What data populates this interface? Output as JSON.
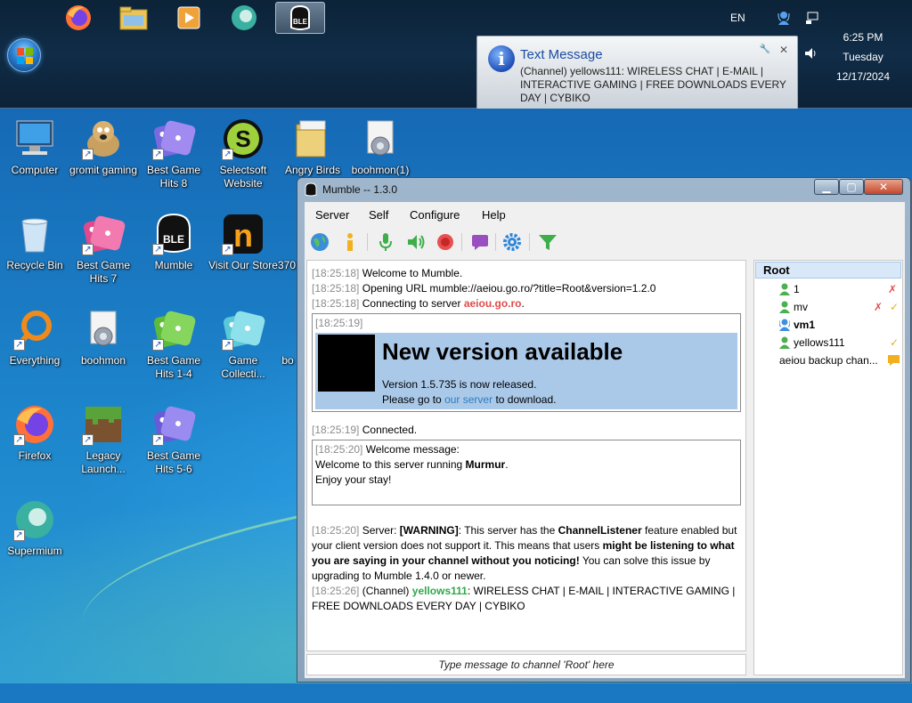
{
  "taskbar": {
    "pinned": [
      {
        "name": "firefox-icon"
      },
      {
        "name": "file-explorer-icon"
      },
      {
        "name": "media-player-icon"
      },
      {
        "name": "supermium-icon"
      },
      {
        "name": "mumble-icon",
        "active": true
      }
    ],
    "language": "EN",
    "clock": {
      "time": "6:25 PM",
      "day": "Tuesday",
      "date": "12/17/2024"
    }
  },
  "notification": {
    "title": "Text Message",
    "text": "(Channel) yellows111: WIRELESS CHAT | E-MAIL | INTERACTIVE GAMING | FREE DOWNLOADS EVERY DAY | CYBIKO"
  },
  "desktop": {
    "icons": [
      {
        "label": "Computer"
      },
      {
        "label": "gromit gaming"
      },
      {
        "label": "Best Game Hits 8"
      },
      {
        "label": "Selectsoft Website"
      },
      {
        "label": "Angry Birds"
      },
      {
        "label": "boohmon(1)"
      },
      {
        "label": "Recycle Bin"
      },
      {
        "label": "Best Game Hits 7"
      },
      {
        "label": "Mumble"
      },
      {
        "label": "Visit Our Store"
      },
      {
        "label": "370"
      },
      {
        "label": "Everything"
      },
      {
        "label": "boohmon"
      },
      {
        "label": "Best Game Hits 1-4"
      },
      {
        "label": "Game Collecti..."
      },
      {
        "label": "bo"
      },
      {
        "label": "Firefox"
      },
      {
        "label": "Legacy Launch..."
      },
      {
        "label": "Best Game Hits 5-6"
      },
      {
        "label": "Supermium"
      }
    ]
  },
  "window": {
    "title": "Mumble -- 1.3.0",
    "menu": [
      "Server",
      "Self",
      "Configure",
      "Help"
    ],
    "toolbar": [
      "connect-icon",
      "info-icon",
      "microphone-icon",
      "speaker-icon",
      "record-icon",
      "chat-bubble-icon",
      "settings-gear-icon",
      "filter-icon"
    ],
    "log": {
      "l1": {
        "ts": "[18:25:18]",
        "text": "Welcome to Mumble."
      },
      "l2": {
        "ts": "[18:25:18]",
        "text": "Opening URL mumble://aeiou.go.ro/?title=Root&version=1.2.0"
      },
      "l3": {
        "ts": "[18:25:18]",
        "text": "Connecting to server",
        "server": "aeiou.go.ro",
        "end": "."
      },
      "l4": {
        "ts": "[18:25:19]",
        "heading": "New version available",
        "p1": "Version 1.5.735 is now released.",
        "p2a": "Please go to",
        "p2link": "our server",
        "p2b": "to download."
      },
      "l5": {
        "ts": "[18:25:19]",
        "text": "Connected."
      },
      "l6": {
        "ts": "[18:25:20]",
        "label": "Welcome message:",
        "w1a": "Welcome to this server running",
        "w1b": "Murmur",
        "w1c": ".",
        "w2": "Enjoy your stay!"
      },
      "l7": {
        "ts": "[18:25:20]",
        "a": "Server:",
        "b": "[WARNING]",
        "c": ": This server has the",
        "d": "ChannelListener",
        "e": "feature enabled but your client version does not support it. This means that users",
        "f": "might be listening to what you are saying in your channel without you noticing!",
        "g": "You can solve this issue by upgrading to Mumble 1.4.0 or newer."
      },
      "l8": {
        "ts": "[18:25:26]",
        "a": "(Channel)",
        "user": "yellows111",
        "msg": ": WIRELESS CHAT | E-MAIL | INTERACTIVE GAMING | FREE DOWNLOADS EVERY DAY | CYBIKO"
      }
    },
    "input_placeholder": "Type message to channel 'Root' here",
    "tree": {
      "root": "Root",
      "users": [
        {
          "name": "1",
          "status": "muted"
        },
        {
          "name": "mv",
          "status": "muted-verified"
        },
        {
          "name": "vm1",
          "status": "self"
        },
        {
          "name": "yellows111",
          "status": "verified"
        },
        {
          "name": "aeiou backup chan...",
          "status": "comment"
        }
      ]
    }
  }
}
